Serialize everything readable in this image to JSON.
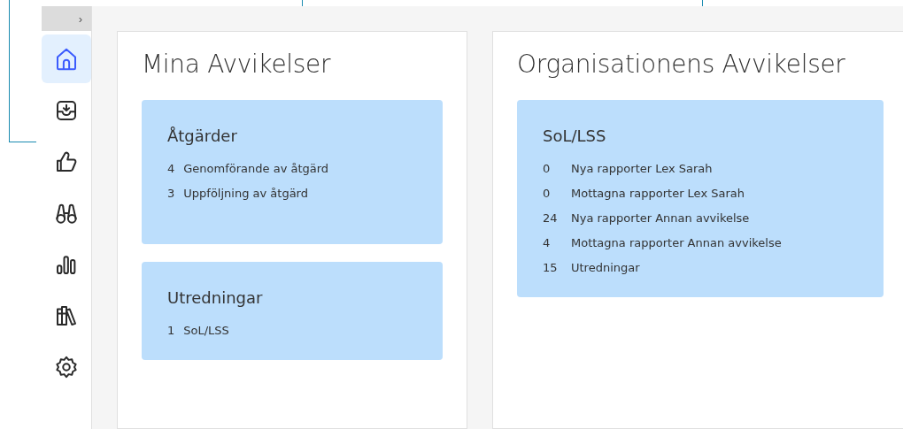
{
  "sidebar": {
    "items": [
      {
        "kind": "home",
        "selected": true
      },
      {
        "kind": "inbox",
        "selected": false
      },
      {
        "kind": "thumb",
        "selected": false
      },
      {
        "kind": "binoculars",
        "selected": false
      },
      {
        "kind": "chart",
        "selected": false
      },
      {
        "kind": "books",
        "selected": false
      },
      {
        "kind": "gear",
        "selected": false
      }
    ],
    "toggle": "›"
  },
  "panels": [
    {
      "title": "Mina Avvikelser",
      "tiles": [
        {
          "title": "Åtgärder",
          "rows": [
            {
              "count": "4",
              "label": "Genomförande av åtgärd"
            },
            {
              "count": "3",
              "label": "Uppföljning av åtgärd"
            }
          ]
        },
        {
          "title": "Utredningar",
          "rows": [
            {
              "count": "1",
              "label": "SoL/LSS"
            }
          ]
        }
      ]
    },
    {
      "title": "Organisationens Avvikelser",
      "tiles": [
        {
          "title": "SoL/LSS",
          "rows": [
            {
              "count": "0",
              "label": "Nya rapporter Lex Sarah"
            },
            {
              "count": "0",
              "label": "Mottagna rapporter Lex Sarah"
            },
            {
              "count": "24",
              "label": "Nya rapporter Annan avvikelse"
            },
            {
              "count": "4",
              "label": "Mottagna rapporter Annan avvikelse"
            },
            {
              "count": "15",
              "label": "Utredningar"
            }
          ]
        }
      ]
    }
  ]
}
